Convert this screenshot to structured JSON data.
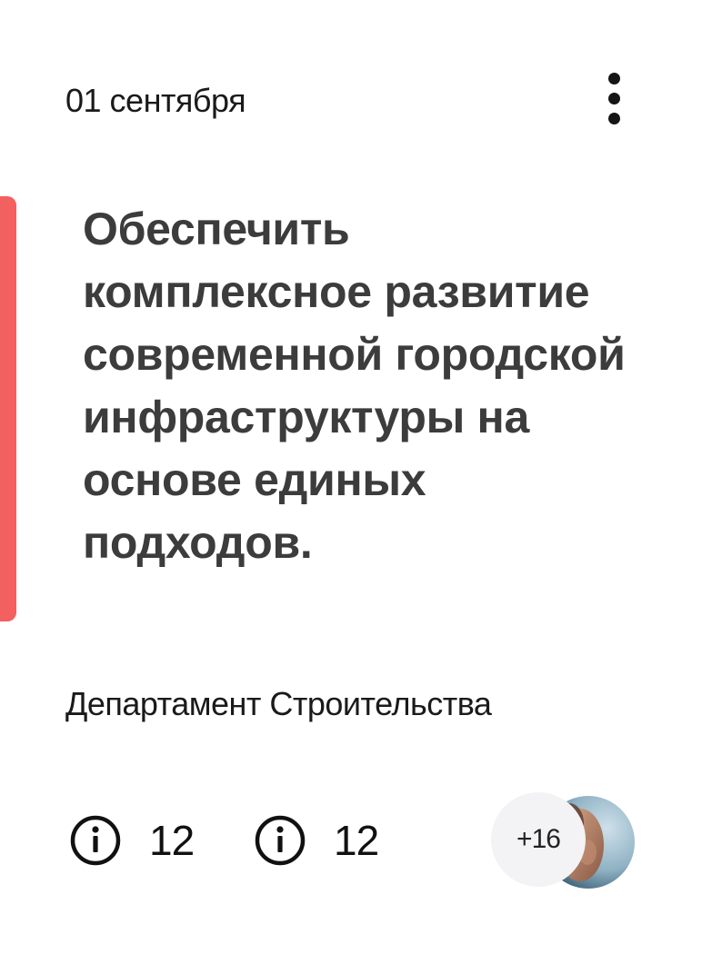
{
  "card": {
    "date": "01 сентября",
    "title": "Обеспечить комплексное развитие современной городской инфраструктуры на основе единых подходов.",
    "department": "Департамент Строительства",
    "stats": [
      {
        "icon": "info-icon",
        "count": "12"
      },
      {
        "icon": "info-icon",
        "count": "12"
      }
    ],
    "participants": {
      "more_label": "+16"
    },
    "menu_icon": "more-vertical-icon"
  },
  "colors": {
    "accent": "#f26060",
    "title": "#3c3c3c",
    "text": "#1a1a1a",
    "badge_bg": "#f3f3f5"
  }
}
